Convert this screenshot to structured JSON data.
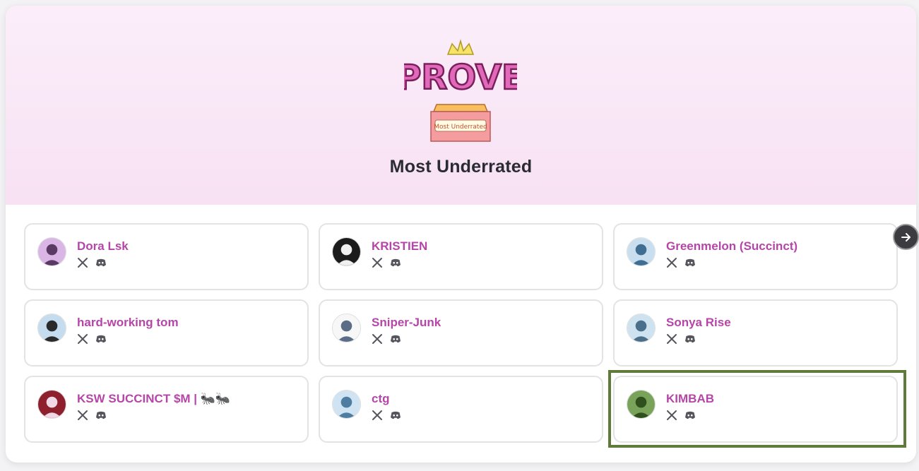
{
  "title": "Most Underrated",
  "logo": {
    "word": "PROVE",
    "badge": "Most Underrated"
  },
  "colors": {
    "accent": "#b645a8",
    "hero_bg": "#fbeefa",
    "highlight": "#5f7a3a"
  },
  "next_button": {
    "icon": "arrow-right-icon"
  },
  "cards": [
    {
      "name": "Dora Lsk",
      "avatar": "avatar-1"
    },
    {
      "name": "KRISTIEN",
      "avatar": "avatar-2"
    },
    {
      "name": "Greenmelon (Succinct)",
      "avatar": "avatar-3"
    },
    {
      "name": "hard-working tom",
      "avatar": "avatar-4"
    },
    {
      "name": "Sniper-Junk",
      "avatar": "avatar-5"
    },
    {
      "name": "Sonya Rise",
      "avatar": "avatar-6"
    },
    {
      "name": "KSW SUCCINCT $M | 🐜🐜",
      "avatar": "avatar-7"
    },
    {
      "name": "ctg",
      "avatar": "avatar-8"
    },
    {
      "name": "KIMBAB",
      "avatar": "avatar-9"
    }
  ]
}
